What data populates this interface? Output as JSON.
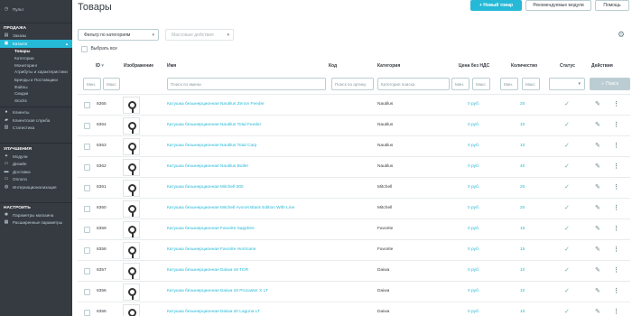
{
  "sidebar": {
    "quick": "Пульт",
    "sections": [
      {
        "title": "ПРОДАЖА"
      },
      {
        "title": "УЛУЧШЕНИЯ"
      },
      {
        "title": "НАСТРОИТЬ"
      }
    ],
    "orders": "Заказы",
    "catalog": "Каталог",
    "catalog_sub": [
      "Товары",
      "Категории",
      "Мониторинг",
      "Атрибуты и характеристики",
      "Бренды и Поставщики",
      "Файлы",
      "Скидки",
      "Stocks"
    ],
    "customers": "Клиенты",
    "service": "Клиентская служба",
    "stats": "Статистика",
    "improve": [
      "Модули",
      "Дизайн",
      "Доставка",
      "Оплата",
      "Интернационализация"
    ],
    "config": [
      "Параметры магазина",
      "Расширенные параметры"
    ]
  },
  "header": {
    "title": "Товары",
    "new_product": "+ Новый товар",
    "recommended": "Рекомендуемые модули",
    "help": "Помощь"
  },
  "toolbar": {
    "filter_category": "Фильтр по категориям",
    "bulk_actions": "Массовые действия",
    "select_all": "Выбрать все"
  },
  "table": {
    "headers": {
      "id": "ID",
      "image": "Изображение",
      "name": "Имя",
      "code": "Код",
      "category": "Категория",
      "price": "Цена без НДС",
      "qty": "Количество",
      "status": "Статус",
      "actions": "Действия"
    },
    "filters": {
      "min": "Мин.",
      "max": "Макс",
      "name": "Поиск по имени",
      "code": "Поиск по артику",
      "category": "Категория поиска",
      "search": "Поиск"
    },
    "rows": [
      {
        "id": "8365",
        "name": "Катушка безынерционная Nautilus Zenon Feeder",
        "code": "",
        "category": "Nautilus",
        "price": "0 руб.",
        "qty": "20"
      },
      {
        "id": "8364",
        "name": "Катушка безынерционная Nautilus Total Feeder",
        "code": "",
        "category": "Nautilus",
        "price": "0 руб.",
        "qty": "10"
      },
      {
        "id": "8363",
        "name": "Катушка безынерционная Nautilus Total Carp",
        "code": "",
        "category": "Nautilus",
        "price": "0 руб.",
        "qty": "10"
      },
      {
        "id": "8362",
        "name": "Катушка безынерционная Nautilus Butler",
        "code": "",
        "category": "Nautilus",
        "price": "0 руб.",
        "qty": "40"
      },
      {
        "id": "8361",
        "name": "Катушка безынерционная Mitchell 300",
        "code": "",
        "category": "Mitchell",
        "price": "0 руб.",
        "qty": "20"
      },
      {
        "id": "8360",
        "name": "Катушка безынерционная Mitchell Avocet Black Edition With Line",
        "code": "",
        "category": "Mitchell",
        "price": "0 руб.",
        "qty": "20"
      },
      {
        "id": "8359",
        "name": "Катушка безынерционная Favorite Sapphire",
        "code": "",
        "category": "Favorite",
        "price": "0 руб.",
        "qty": "15"
      },
      {
        "id": "8358",
        "name": "Катушка безынерционная Favorite Hurricane",
        "code": "",
        "category": "Favorite",
        "price": "0 руб.",
        "qty": "15"
      },
      {
        "id": "8357",
        "name": "Катушка безынерционная Daiwa 18 TDR",
        "code": "",
        "category": "Daiwa",
        "price": "0 руб.",
        "qty": "10"
      },
      {
        "id": "8356",
        "name": "Катушка безынерционная Daiwa 18 Procaster X LT",
        "code": "",
        "category": "Daiwa",
        "price": "0 руб.",
        "qty": "10"
      },
      {
        "id": "8355",
        "name": "Катушка безынерционная Daiwa 20 Laguna LT",
        "code": "",
        "category": "Daiwa",
        "price": "0 руб.",
        "qty": "10"
      }
    ]
  },
  "colors": {
    "accent": "#25b9d7",
    "sidebar": "#363a41",
    "status_ok": "#70b580"
  }
}
